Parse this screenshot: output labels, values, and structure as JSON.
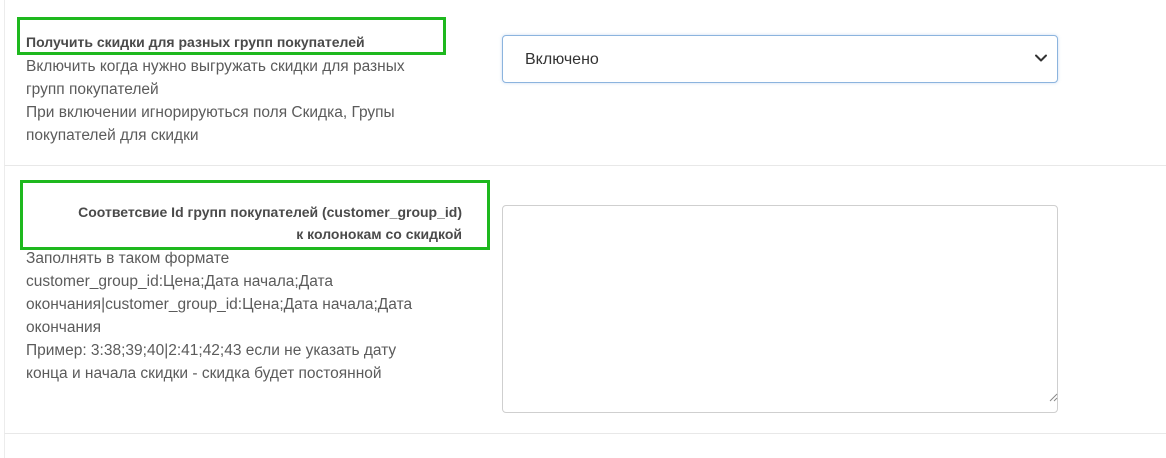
{
  "rows": [
    {
      "title": "Получить скидки для разных групп покупателей",
      "help_lines": [
        "Включить когда нужно выгружать скидки для разных",
        "групп покупателей",
        "При включении игнорируються поля Скидка, Групы",
        "покупателей для скидки"
      ],
      "select": {
        "selected_value": "Включено",
        "icon": "chevron-down-icon"
      }
    },
    {
      "title_lines": [
        "Соответсвие Id групп покупателей (customer_group_id)",
        "к колонокам со скидкой"
      ],
      "help_lines": [
        "Заполнять в таком формате",
        "customer_group_id:Цена;Дата начала;Дата",
        "окончания|customer_group_id:Цена;Дата начала;Дата",
        "окончания",
        "Пример: 3:38;39;40|2:41;42;43 если не указать дату",
        "конца и начала скидки - скидка будет постоянной"
      ],
      "textarea": {
        "value": ""
      }
    }
  ],
  "colors": {
    "highlight": "#1eb81e",
    "select_border": "#8cb4de",
    "text": "#5b5b5b"
  }
}
